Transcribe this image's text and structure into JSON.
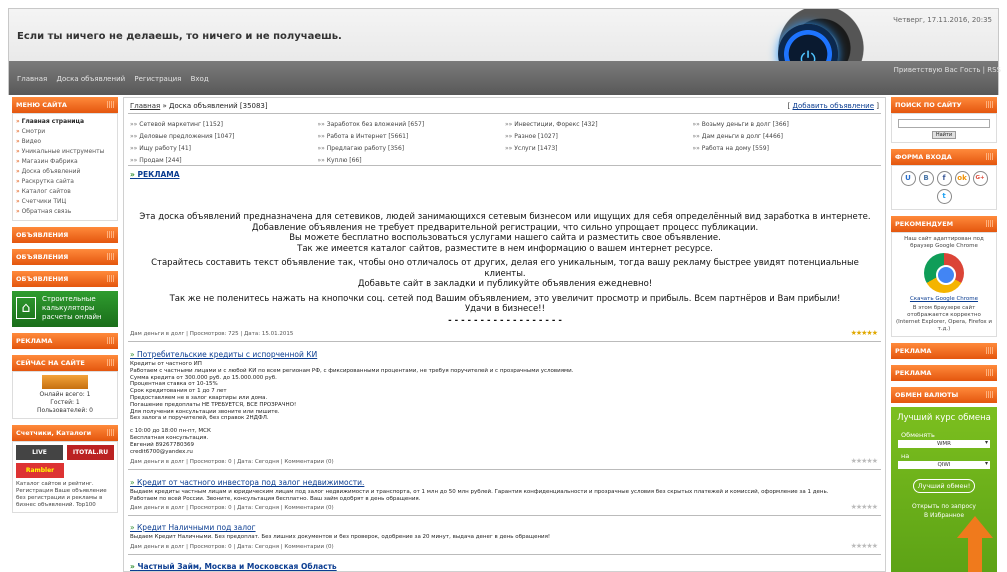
{
  "header": {
    "motto": "Если ты ничего не делаешь, то ничего и не получаешь.",
    "datetime": "Четверг, 17.11.2016, 20:35",
    "nav": [
      "Главная",
      "Доска объявлений",
      "Регистрация",
      "Вход"
    ],
    "guest": "Приветствую Вас Гость | RSS"
  },
  "left": {
    "menu_title": "МЕНЮ САЙТА",
    "menu": [
      "Главная страница",
      "Смотри",
      "Видео",
      "Уникальные инструменты",
      "Магазин Фабрика",
      "Доска объявлений",
      "Раскрутка сайта",
      "Каталог сайтов",
      "Счетчики ТИЦ",
      "Обратная связь"
    ],
    "block_obyav_1": "ОБЪЯВЛЕНИЯ",
    "block_obyav_2": "ОБЪЯВЛЕНИЯ",
    "block_obyav_3": "ОБЪЯВЛЕНИЯ",
    "banner_text": "Строительные калькуляторы расчеты онлайн",
    "reklama_title": "РЕКЛАМА",
    "now_title": "СЕЙЧАС НА САЙТЕ",
    "online_total": "Онлайн всего: 1",
    "guests": "Гостей: 1",
    "users": "Пользователей: 0",
    "counters_title": "Счетчики, Каталоги",
    "counter1": "LIVE",
    "counter2": "ITOTAL.RU",
    "counter3": "Rambler",
    "small_text": "Каталог сайтов и рейтинг. Регистрация Ваше объявление без регистрации и рекламы в бизнес объявлений. Top100"
  },
  "main": {
    "breadcrumb_home": "Главная",
    "breadcrumb_current": "Доска объявлений [35083]",
    "add_ad": "Добавить объявление",
    "categories": [
      "Сетевой маркетинг [1152]",
      "Заработок без вложений [657]",
      "Инвестиции, Форекс [432]",
      "Возьму деньги в долг [366]",
      "Деловые предложения [1047]",
      "Работа в Интернет [5661]",
      "Разное [1027]",
      "Дам деньги в долг [4466]",
      "Ищу работу [41]",
      "Предлагаю работу [356]",
      "Услуги [1473]",
      "Работа на дому [559]",
      "Продам [244]",
      "Куплю [66]"
    ],
    "reklama": "РЕКЛАМА",
    "intro": [
      "Эта доска объявлений предназначена для сетевиков, людей занимающихся сетевым бизнесом или ищущих для себя определённый вид заработка в интернете.",
      "Добавление объявления не требует предварительной регистрации, что сильно упрощает процесс публикации.",
      "Вы можете бесплатно воспользоваться услугами нашего сайта и разместить свое объявление.",
      "Так же имеется каталог сайтов, разместите в нем информацию о вашем интернет ресурсе.",
      "Старайтесь составить текст объявление так, чтобы оно отличалось от других, делая его уникальным, тогда вашу рекламу быстрее увидят потенциальные клиенты.",
      "Добавьте сайт в закладки и публикуйте объявления ежедневно!",
      "Так же не поленитесь нажать на кнопочки соц. сетей под Вашим объявлением, это увеличит просмотр и прибыль. Всем партнёров и Вам прибыли!",
      "Удачи в бизнесе!!",
      "- - - - - - - - - - - - - - - - - -"
    ],
    "meta1": "Дам деньги в долг | Просмотров: 725 | Дата: 15.01.2015",
    "ad1_title": "Потребительские кредиты с испорченной КИ",
    "ad1_text": [
      "Кредиты от частного ИП",
      "Работаем с частными лицами и с любой КИ по всем регионам РФ, с фиксированными процентами, не требуя поручителей и с прозрачными условиями.",
      "Сумма кредита от 300.000 руб. до 15.000.000 руб.",
      "Процентная ставка от 10-15%",
      "Срок кредитования от 1 до 7 лет",
      "Предоставляем не в залог квартиры или дома.",
      "Погашение предоплаты НЕ ТРЕБУЕТСЯ, ВСЕ ПРОЗРАЧНО!",
      "Для получения консультации звоните или пишите.",
      "Без залога и поручителей, без справок 2НДФЛ.",
      "",
      "с 10:00 до 18:00 пн-пт, МСК",
      "Бесплатная консультация.",
      "Евгений 89267780369",
      "credit6700@yandex.ru"
    ],
    "meta2": "Дам деньги в долг | Просмотров: 0 | Дата: Сегодня | Комментарии (0)",
    "ad2_title": "Кредит от частного инвестора под залог недвижимости.",
    "ad2_text": [
      "Выдаем кредиты частным лицам и юридическим лицам под залог недвижимости и транспорта, от 1 млн до 50 млн рублей. Гарантия конфиденциальности и прозрачные условия без скрытых платежей и комиссий, оформление за 1 день.",
      "Работаем по всей России. Звоните, консультация бесплатно. Ваш займ одобрят в день обращения."
    ],
    "meta3": "Дам деньги в долг | Просмотров: 0 | Дата: Сегодня | Комментарии (0)",
    "ad3_title": "Кредит Наличными под залог",
    "ad3_text": "Выдаем Кредит Наличными. Без предоплат. Без лишних документов и без проверок, одобрение за 20 минут, выдача денег в день обращения!",
    "meta4": "Дам деньги в долг | Просмотров: 0 | Дата: Сегодня | Комментарии (0)",
    "ad4_title": "Частный Займ, Москва и Московская Область"
  },
  "right": {
    "search_title": "ПОИСК ПО САЙТУ",
    "search_btn": "Найти",
    "login_title": "ФОРМА ВХОДА",
    "social": [
      "U",
      "B",
      "f",
      "ok",
      "G+",
      "t"
    ],
    "recommend_title": "РЕКОМЕНДУЕМ",
    "recommend_text": "Наш сайт адаптирован под браузер Google Chrome",
    "chrome_link": "Скачать Google Chrome",
    "recommend_small": "В этом браузере сайт отображается корректно (Internet Explorer, Opera, Firefox и т.д.)",
    "reklama1": "РЕКЛАМА",
    "reklama2": "РЕКЛАМА",
    "exchange_title": "ОБМЕН ВАЛЮТЫ",
    "exchange_big": "Лучший курс обмена",
    "give_label": "Обменять",
    "give_value": "WMR",
    "get_label": "на",
    "get_value": "QIWI",
    "exchange_btn": "Лучший обмен!",
    "open_partners": "Открыть по запросу",
    "in_select": "В Избранное"
  },
  "colors": {
    "accent": "#e4560e",
    "link": "#0b3d91",
    "green": "#2f9c2f"
  }
}
